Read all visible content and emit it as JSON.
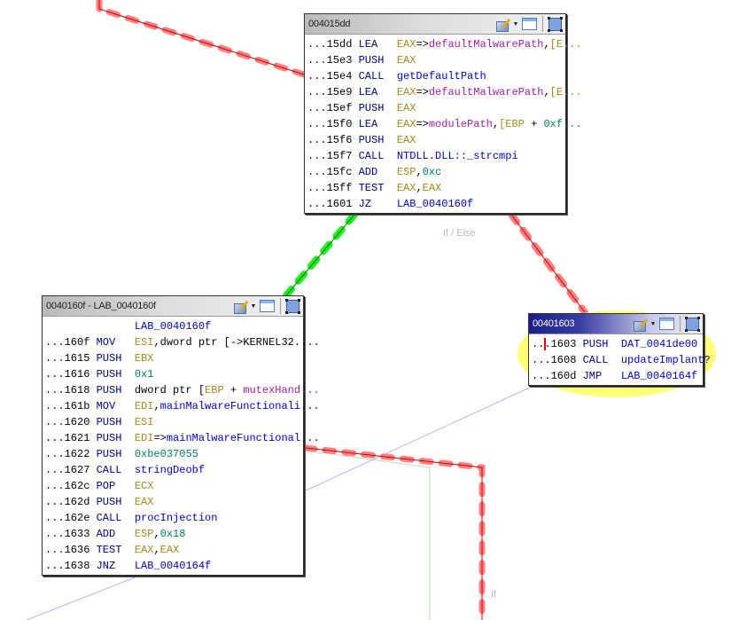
{
  "graph": {
    "edge_labels": {
      "if_else": "If / Else",
      "if": "If"
    },
    "colors": {
      "false_edge": "#ff7f7f",
      "false_edge_core": "#d00000",
      "true_edge": "#22ee22",
      "true_edge_core": "#107010",
      "flow_edge": "#b0b0ff",
      "fallthrough_edge": "#b8d8b8",
      "highlight": "#ffff66"
    }
  },
  "blocks": [
    {
      "id": "b1",
      "title": "004015dd",
      "active": false,
      "lines": [
        [
          [
            "addr",
            "...15dd "
          ],
          [
            "mn",
            "LEA  "
          ],
          [
            "plain",
            " "
          ],
          [
            "reg",
            "EAX"
          ],
          [
            "plain",
            "=>"
          ],
          [
            "sym",
            "defaultMalwarePath"
          ],
          [
            "plain",
            ","
          ],
          [
            "reg",
            "[E..."
          ]
        ],
        [
          [
            "addr",
            "...15e3 "
          ],
          [
            "mn",
            "PUSH "
          ],
          [
            "plain",
            " "
          ],
          [
            "reg",
            "EAX"
          ]
        ],
        [
          [
            "addr",
            "...15e4 "
          ],
          [
            "mn",
            "CALL "
          ],
          [
            "plain",
            " "
          ],
          [
            "lbl",
            "getDefaultPath"
          ]
        ],
        [
          [
            "addr",
            "...15e9 "
          ],
          [
            "mn",
            "LEA  "
          ],
          [
            "plain",
            " "
          ],
          [
            "reg",
            "EAX"
          ],
          [
            "plain",
            "=>"
          ],
          [
            "sym",
            "defaultMalwarePath"
          ],
          [
            "plain",
            ","
          ],
          [
            "reg",
            "[E..."
          ]
        ],
        [
          [
            "addr",
            "...15ef "
          ],
          [
            "mn",
            "PUSH "
          ],
          [
            "plain",
            " "
          ],
          [
            "reg",
            "EAX"
          ]
        ],
        [
          [
            "addr",
            "...15f0 "
          ],
          [
            "mn",
            "LEA  "
          ],
          [
            "plain",
            " "
          ],
          [
            "reg",
            "EAX"
          ],
          [
            "plain",
            "=>"
          ],
          [
            "sym",
            "modulePath"
          ],
          [
            "plain",
            ","
          ],
          [
            "reg",
            "[EBP"
          ],
          [
            "plain",
            " + "
          ],
          [
            "num",
            "0xf..."
          ]
        ],
        [
          [
            "addr",
            "...15f6 "
          ],
          [
            "mn",
            "PUSH "
          ],
          [
            "plain",
            " "
          ],
          [
            "reg",
            "EAX"
          ]
        ],
        [
          [
            "addr",
            "...15f7 "
          ],
          [
            "mn",
            "CALL "
          ],
          [
            "plain",
            " "
          ],
          [
            "lbl",
            "NTDLL.DLL::_strcmpi"
          ]
        ],
        [
          [
            "addr",
            "...15fc "
          ],
          [
            "mn",
            "ADD  "
          ],
          [
            "plain",
            " "
          ],
          [
            "reg",
            "ESP"
          ],
          [
            "plain",
            ","
          ],
          [
            "num",
            "0xc"
          ]
        ],
        [
          [
            "addr",
            "...15ff "
          ],
          [
            "mn",
            "TEST "
          ],
          [
            "plain",
            " "
          ],
          [
            "reg",
            "EAX"
          ],
          [
            "plain",
            ","
          ],
          [
            "reg",
            "EAX"
          ]
        ],
        [
          [
            "addr",
            "...1601 "
          ],
          [
            "mn",
            "JZ   "
          ],
          [
            "plain",
            " "
          ],
          [
            "lbl",
            "LAB_0040160f"
          ]
        ]
      ]
    },
    {
      "id": "b2",
      "title": "0040160f - LAB_0040160f",
      "active": false,
      "lines": [
        [
          [
            "plain",
            "              "
          ],
          [
            "lbl",
            "LAB_0040160f"
          ]
        ],
        [
          [
            "addr",
            "...160f "
          ],
          [
            "mn",
            "MOV  "
          ],
          [
            "plain",
            " "
          ],
          [
            "reg",
            "ESI"
          ],
          [
            "plain",
            ",dword ptr [->KERNEL32...."
          ]
        ],
        [
          [
            "addr",
            "...1615 "
          ],
          [
            "mn",
            "PUSH "
          ],
          [
            "plain",
            " "
          ],
          [
            "reg",
            "EBX"
          ]
        ],
        [
          [
            "addr",
            "...1616 "
          ],
          [
            "mn",
            "PUSH "
          ],
          [
            "plain",
            " "
          ],
          [
            "num",
            "0x1"
          ]
        ],
        [
          [
            "addr",
            "...1618 "
          ],
          [
            "mn",
            "PUSH "
          ],
          [
            "plain",
            " dword ptr ["
          ],
          [
            "reg",
            "EBP"
          ],
          [
            "plain",
            " + "
          ],
          [
            "sym",
            "mutexHand..."
          ]
        ],
        [
          [
            "addr",
            "...161b "
          ],
          [
            "mn",
            "MOV  "
          ],
          [
            "plain",
            " "
          ],
          [
            "reg",
            "EDI"
          ],
          [
            "plain",
            ","
          ],
          [
            "lbl",
            "mainMalwareFunctionali..."
          ]
        ],
        [
          [
            "addr",
            "...1620 "
          ],
          [
            "mn",
            "PUSH "
          ],
          [
            "plain",
            " "
          ],
          [
            "reg",
            "ESI"
          ]
        ],
        [
          [
            "addr",
            "...1621 "
          ],
          [
            "mn",
            "PUSH "
          ],
          [
            "plain",
            " "
          ],
          [
            "reg",
            "EDI"
          ],
          [
            "plain",
            "=>"
          ],
          [
            "lbl",
            "mainMalwareFunctional..."
          ]
        ],
        [
          [
            "addr",
            "...1622 "
          ],
          [
            "mn",
            "PUSH "
          ],
          [
            "plain",
            " "
          ],
          [
            "num",
            "0xbe037055"
          ]
        ],
        [
          [
            "addr",
            "...1627 "
          ],
          [
            "mn",
            "CALL "
          ],
          [
            "plain",
            " "
          ],
          [
            "lbl",
            "stringDeobf"
          ]
        ],
        [
          [
            "addr",
            "...162c "
          ],
          [
            "mn",
            "POP  "
          ],
          [
            "plain",
            " "
          ],
          [
            "reg",
            "ECX"
          ]
        ],
        [
          [
            "addr",
            "...162d "
          ],
          [
            "mn",
            "PUSH "
          ],
          [
            "plain",
            " "
          ],
          [
            "reg",
            "EAX"
          ]
        ],
        [
          [
            "addr",
            "...162e "
          ],
          [
            "mn",
            "CALL "
          ],
          [
            "plain",
            " "
          ],
          [
            "lbl",
            "procInjection"
          ]
        ],
        [
          [
            "addr",
            "...1633 "
          ],
          [
            "mn",
            "ADD  "
          ],
          [
            "plain",
            " "
          ],
          [
            "reg",
            "ESP"
          ],
          [
            "plain",
            ","
          ],
          [
            "num",
            "0x18"
          ]
        ],
        [
          [
            "addr",
            "...1636 "
          ],
          [
            "mn",
            "TEST "
          ],
          [
            "plain",
            " "
          ],
          [
            "reg",
            "EAX"
          ],
          [
            "plain",
            ","
          ],
          [
            "reg",
            "EAX"
          ]
        ],
        [
          [
            "addr",
            "...1638 "
          ],
          [
            "mn",
            "JNZ  "
          ],
          [
            "plain",
            " "
          ],
          [
            "lbl",
            "LAB_0040164f"
          ]
        ]
      ]
    },
    {
      "id": "b3",
      "title": "00401603",
      "active": true,
      "lines": [
        [
          [
            "addr",
            "...1603 "
          ],
          [
            "mn",
            "PUSH "
          ],
          [
            "plain",
            " "
          ],
          [
            "lbl",
            "DAT_0041de00"
          ]
        ],
        [
          [
            "addr",
            "...1608 "
          ],
          [
            "mn",
            "CALL "
          ],
          [
            "plain",
            " "
          ],
          [
            "lbl",
            "updateImplant?"
          ]
        ],
        [
          [
            "addr",
            "...160d "
          ],
          [
            "mn",
            "JMP  "
          ],
          [
            "plain",
            " "
          ],
          [
            "lbl",
            "LAB_0040164f"
          ]
        ]
      ]
    }
  ],
  "toolbar": {
    "icons": [
      "edit-brush-icon",
      "dropdown-caret-icon",
      "window-icon",
      "maximize-icon"
    ]
  }
}
